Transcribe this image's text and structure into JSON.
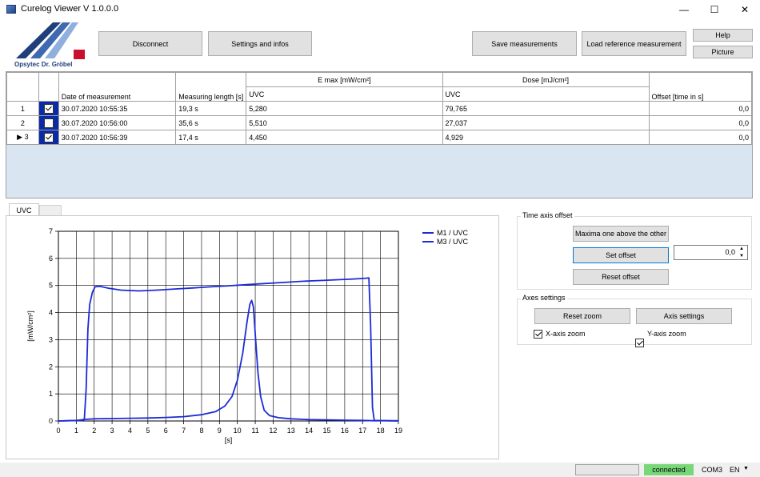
{
  "window": {
    "title": "Curelog Viewer V 1.0.0.0",
    "min_glyph": "—",
    "max_glyph": "☐",
    "close_glyph": "✕"
  },
  "logo": {
    "text": "Opsytec Dr. Gröbel",
    "colors": [
      "#1f3f7a",
      "#3f69b0",
      "#8fb0df",
      "#c8102e"
    ]
  },
  "toolbar": {
    "disconnect": "Disconnect",
    "settings": "Settings and infos",
    "save": "Save measurements",
    "load_ref": "Load reference measurement",
    "help": "Help",
    "picture": "Picture"
  },
  "table": {
    "group_emax": "E max [mW/cm²]",
    "group_dose": "Dose [mJ/cm²]",
    "col_date": "Date of measurement",
    "col_length": "Measuring length [s]",
    "col_emax_uvc": "UVC",
    "col_dose_uvc": "UVC",
    "col_offset": "Offset [time in s]",
    "rows": [
      {
        "index": "1",
        "checked": true,
        "date": "30.07.2020  10:55:35",
        "length": "19,3 s",
        "emax": "5,280",
        "dose": "79,765",
        "offset": "0,0",
        "marker": ""
      },
      {
        "index": "2",
        "checked": false,
        "date": "30.07.2020  10:56:00",
        "length": "35,6 s",
        "emax": "5,510",
        "dose": "27,037",
        "offset": "0,0",
        "marker": ""
      },
      {
        "index": "3",
        "checked": true,
        "date": "30.07.2020  10:56:39",
        "length": "17,4 s",
        "emax": "4,450",
        "dose": "4,929",
        "offset": "0,0",
        "marker": "▶"
      }
    ]
  },
  "tabs": {
    "uvc": "UVC"
  },
  "chart_data": {
    "type": "line",
    "title": "",
    "xlabel": "[s]",
    "ylabel": "[mW/cm²]",
    "xlim": [
      0,
      19
    ],
    "ylim": [
      0,
      7
    ],
    "x_ticks": [
      "0",
      "1",
      "2",
      "3",
      "4",
      "5",
      "6",
      "7",
      "8",
      "9",
      "10",
      "11",
      "12",
      "13",
      "14",
      "15",
      "16",
      "17",
      "18",
      "19"
    ],
    "y_ticks": [
      "0",
      "1",
      "2",
      "3",
      "4",
      "5",
      "6",
      "7"
    ],
    "grid": true,
    "legend_position": "top-right",
    "series": [
      {
        "name": "M1 / UVC",
        "color": "#1c2bd6",
        "points": [
          [
            0,
            0
          ],
          [
            1.3,
            0.02
          ],
          [
            1.45,
            0.05
          ],
          [
            1.55,
            1.2
          ],
          [
            1.65,
            3.4
          ],
          [
            1.75,
            4.3
          ],
          [
            1.9,
            4.75
          ],
          [
            2.05,
            4.95
          ],
          [
            2.3,
            4.97
          ],
          [
            2.8,
            4.9
          ],
          [
            3.5,
            4.83
          ],
          [
            4.5,
            4.8
          ],
          [
            5.5,
            4.83
          ],
          [
            6.5,
            4.87
          ],
          [
            7.5,
            4.91
          ],
          [
            8.5,
            4.95
          ],
          [
            9.5,
            4.99
          ],
          [
            10.5,
            5.03
          ],
          [
            11.5,
            5.07
          ],
          [
            12.5,
            5.11
          ],
          [
            13.5,
            5.15
          ],
          [
            14.5,
            5.18
          ],
          [
            15.5,
            5.21
          ],
          [
            16.5,
            5.24
          ],
          [
            17.2,
            5.27
          ],
          [
            17.35,
            5.28
          ],
          [
            17.45,
            3.5
          ],
          [
            17.55,
            0.5
          ],
          [
            17.65,
            0.02
          ],
          [
            19,
            0
          ]
        ]
      },
      {
        "name": "M3 / UVC",
        "color": "#1c2bd6",
        "points": [
          [
            0,
            0
          ],
          [
            1,
            0.02
          ],
          [
            1.5,
            0.06
          ],
          [
            2,
            0.08
          ],
          [
            3,
            0.09
          ],
          [
            4,
            0.1
          ],
          [
            5,
            0.11
          ],
          [
            6,
            0.13
          ],
          [
            7,
            0.16
          ],
          [
            8,
            0.23
          ],
          [
            8.8,
            0.35
          ],
          [
            9.3,
            0.55
          ],
          [
            9.7,
            0.9
          ],
          [
            10.0,
            1.5
          ],
          [
            10.3,
            2.5
          ],
          [
            10.55,
            3.7
          ],
          [
            10.7,
            4.3
          ],
          [
            10.8,
            4.45
          ],
          [
            10.9,
            4.2
          ],
          [
            11.0,
            3.2
          ],
          [
            11.15,
            1.8
          ],
          [
            11.3,
            0.9
          ],
          [
            11.5,
            0.4
          ],
          [
            11.8,
            0.2
          ],
          [
            12.3,
            0.12
          ],
          [
            13,
            0.08
          ],
          [
            14,
            0.05
          ],
          [
            15,
            0.04
          ],
          [
            16,
            0.03
          ],
          [
            17,
            0.02
          ],
          [
            17.6,
            0.01
          ],
          [
            19,
            0.01
          ]
        ]
      }
    ]
  },
  "time_offset": {
    "label": "Time axis offset",
    "maxima": "Maxima one above the other",
    "set_offset": "Set offset",
    "reset_offset": "Reset offset",
    "offset_value": "0,0"
  },
  "axes": {
    "label": "Axes settings",
    "reset_zoom": "Reset zoom",
    "axis_settings": "Axis settings",
    "x_zoom": "X-axis zoom",
    "y_zoom": "Y-axis zoom",
    "x_zoom_checked": true,
    "y_zoom_checked": true
  },
  "status": {
    "connected": "connected",
    "port": "COM3",
    "lang": "EN"
  }
}
